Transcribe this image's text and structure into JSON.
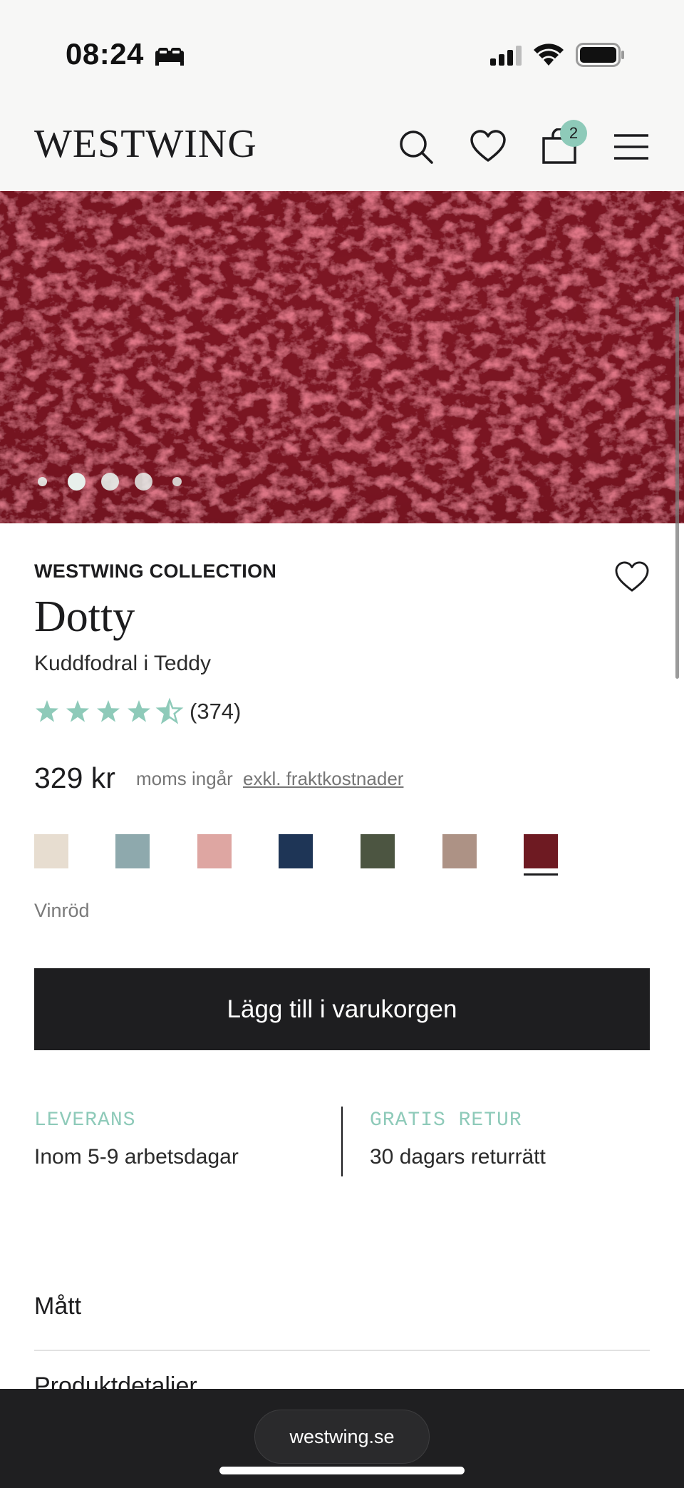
{
  "status_bar": {
    "time": "08:24"
  },
  "header": {
    "logo": "WESTWING",
    "cart_count": "2",
    "icons": [
      "search-icon",
      "heart-icon",
      "bag-icon",
      "menu-icon"
    ]
  },
  "gallery": {
    "slide_count": 5,
    "active_index": 1
  },
  "product": {
    "brand": "WESTWING COLLECTION",
    "name": "Dotty",
    "subtitle": "Kuddfodral i Teddy",
    "rating": 4.5,
    "rating_count": "(374)",
    "price": "329 kr",
    "vat_note": "moms ingår",
    "shipping_link": "exkl. fraktkostnader"
  },
  "colors": {
    "swatches": [
      "#e7ddd0",
      "#8ea9ad",
      "#dea6a2",
      "#1e3556",
      "#4c5541",
      "#ad9285",
      "#6e1a22"
    ],
    "selected_index": 6,
    "selected_name": "Vinröd"
  },
  "cta": {
    "label": "Lägg till i varukorgen"
  },
  "info": {
    "delivery_label": "LEVERANS",
    "delivery_value": "Inom 5-9 arbetsdagar",
    "return_label": "GRATIS RETUR",
    "return_value": "30 dagars returrätt"
  },
  "accordion": {
    "items": [
      "Mått",
      "Produktdetaljer"
    ]
  },
  "browser": {
    "url": "westwing.se"
  },
  "theme": {
    "accent": "#8ecab9",
    "dark": "#1e1e20"
  }
}
